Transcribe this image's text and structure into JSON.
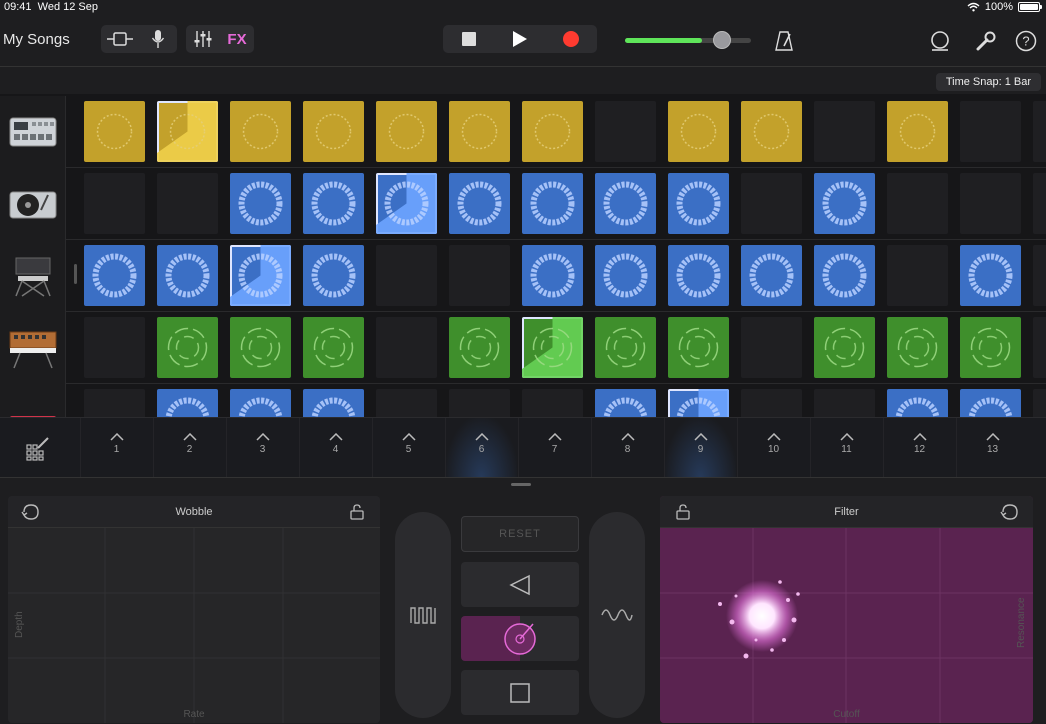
{
  "status": {
    "time": "09:41",
    "date": "Wed 12 Sep",
    "battery": "100%"
  },
  "toolbar": {
    "title": "My Songs",
    "fx_label": "FX",
    "volume": 0.77
  },
  "time_snap": "Time Snap: 1 Bar",
  "instruments": [
    "drum-machine",
    "turntable",
    "synth-keyboard",
    "analog-synth",
    "keyboard"
  ],
  "grid": [
    [
      "Y",
      "Ya",
      "Y",
      "Y",
      "Y",
      "Y",
      "Y",
      "E",
      "Y",
      "Y",
      "E",
      "Y",
      "E",
      "E"
    ],
    [
      "E",
      "E",
      "B",
      "B",
      "Ba",
      "B",
      "B",
      "B",
      "B",
      "E",
      "B",
      "E",
      "E",
      "E"
    ],
    [
      "B",
      "B",
      "Ba",
      "B",
      "E",
      "E",
      "B",
      "B",
      "B",
      "B",
      "B",
      "E",
      "B",
      "E"
    ],
    [
      "E",
      "G",
      "G",
      "G",
      "E",
      "G",
      "Ga",
      "G",
      "G",
      "E",
      "G",
      "G",
      "G",
      "E"
    ],
    [
      "E",
      "B",
      "B",
      "B",
      "E",
      "E",
      "E",
      "B",
      "Ba",
      "E",
      "E",
      "B",
      "B",
      "E"
    ]
  ],
  "scenes": [
    "1",
    "2",
    "3",
    "4",
    "5",
    "6",
    "7",
    "8",
    "9",
    "10",
    "11",
    "12",
    "13"
  ],
  "left_pad": {
    "title": "Wobble",
    "x_label": "Rate",
    "y_label": "Depth"
  },
  "right_pad": {
    "title": "Filter",
    "x_label": "Cutoff",
    "y_label": "Resonance",
    "color": "#5a2350"
  },
  "controls": {
    "reset_label": "RESET"
  },
  "colors": {
    "yellow": "#c3a12b",
    "blue": "#3b6fc5",
    "green": "#3f8f2c",
    "accent": "#e66ad8",
    "record": "#ff3b30"
  }
}
